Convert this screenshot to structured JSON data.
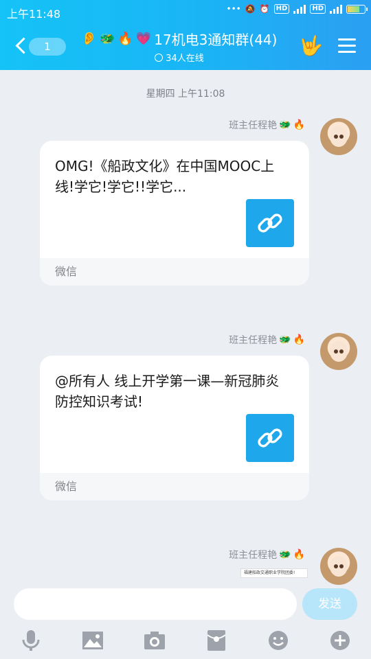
{
  "status_bar": {
    "time": "上午11:48",
    "network1": "HD",
    "network2": "HD",
    "gen": "4G"
  },
  "header": {
    "back_badge": "1",
    "title": "17机电3通知群(44)",
    "online": "34人在线",
    "title_emojis": [
      "🐲",
      "🔥",
      "💗"
    ]
  },
  "chat": {
    "date_label": "星期四 上午11:08",
    "messages": [
      {
        "sender": "班主任程艳",
        "text": "OMG!《船政文化》在中国MOOC上线!学它!学它!!学它...",
        "source": "微信"
      },
      {
        "sender": "班主任程艳",
        "text": "@所有人 线上开学第一课—新冠肺炎防控知识考试!",
        "source": "微信"
      },
      {
        "sender": "班主任程艳",
        "preview": "福建船政交通职业学院团委!"
      }
    ]
  },
  "input": {
    "send_label": "发送"
  },
  "colors": {
    "header_start": "#15c3f7",
    "header_end": "#2b9ff2",
    "link_tile": "#1ea7eb",
    "send_button": "#b7e5fa"
  }
}
